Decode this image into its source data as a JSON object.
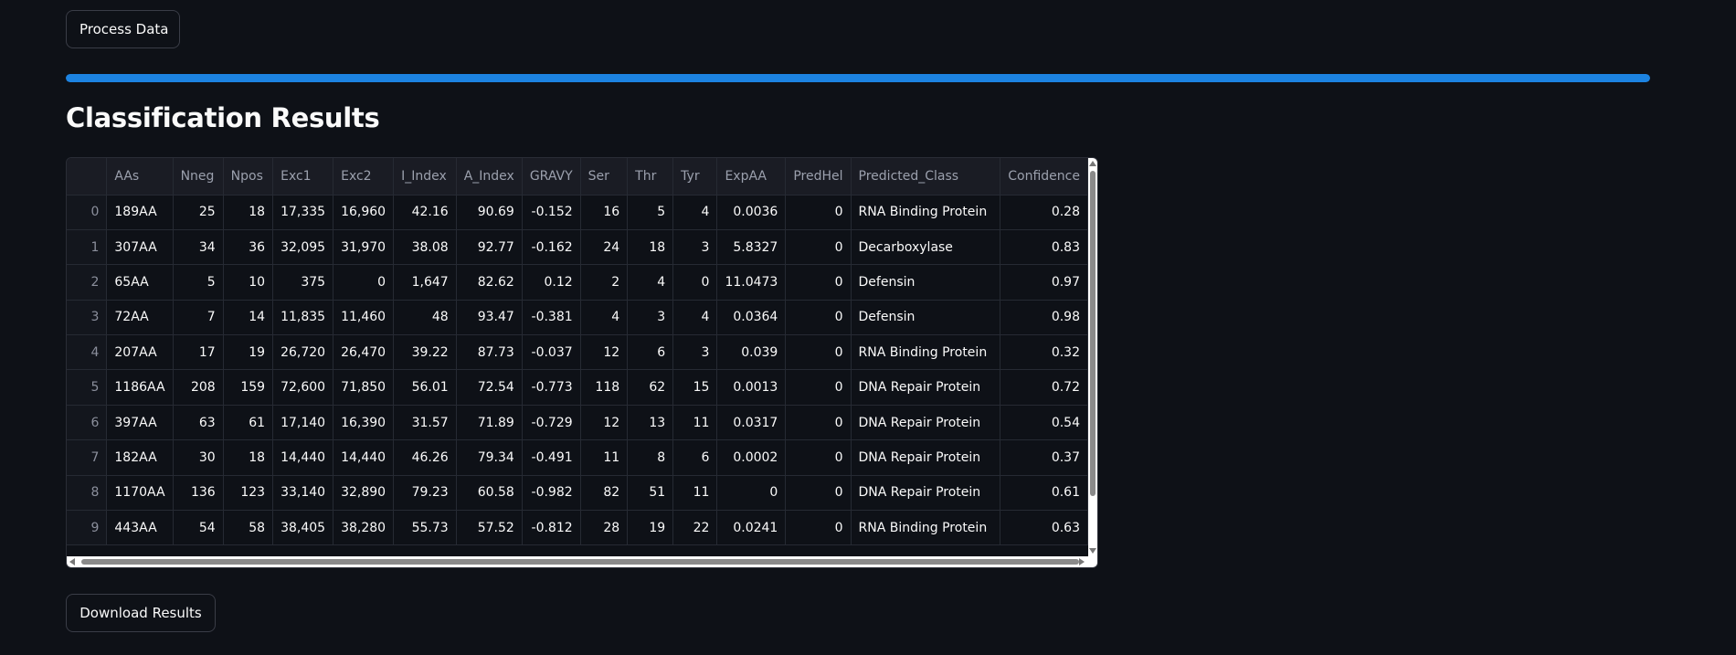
{
  "buttons": {
    "process_label": "Process Data",
    "download_label": "Download Results"
  },
  "progress": {
    "fraction": 1.0,
    "color": "#1c83e1"
  },
  "results": {
    "title": "Classification Results",
    "columns": [
      "",
      "AAs",
      "Nneg",
      "Npos",
      "Exc1",
      "Exc2",
      "I_Index",
      "A_Index",
      "GRAVY",
      "Ser",
      "Thr",
      "Tyr",
      "ExpAA",
      "PredHel",
      "Predicted_Class",
      "Confidence"
    ],
    "rows": [
      [
        "0",
        "189AA",
        "25",
        "18",
        "17,335",
        "16,960",
        "42.16",
        "90.69",
        "-0.152",
        "16",
        "5",
        "4",
        "0.0036",
        "0",
        "RNA Binding Protein",
        "0.28"
      ],
      [
        "1",
        "307AA",
        "34",
        "36",
        "32,095",
        "31,970",
        "38.08",
        "92.77",
        "-0.162",
        "24",
        "18",
        "3",
        "5.8327",
        "0",
        "Decarboxylase",
        "0.83"
      ],
      [
        "2",
        "65AA",
        "5",
        "10",
        "375",
        "0",
        "1,647",
        "82.62",
        "0.12",
        "2",
        "4",
        "0",
        "11.0473",
        "0",
        "Defensin",
        "0.97"
      ],
      [
        "3",
        "72AA",
        "7",
        "14",
        "11,835",
        "11,460",
        "48",
        "93.47",
        "-0.381",
        "4",
        "3",
        "4",
        "0.0364",
        "0",
        "Defensin",
        "0.98"
      ],
      [
        "4",
        "207AA",
        "17",
        "19",
        "26,720",
        "26,470",
        "39.22",
        "87.73",
        "-0.037",
        "12",
        "6",
        "3",
        "0.039",
        "0",
        "RNA Binding Protein",
        "0.32"
      ],
      [
        "5",
        "1186AA",
        "208",
        "159",
        "72,600",
        "71,850",
        "56.01",
        "72.54",
        "-0.773",
        "118",
        "62",
        "15",
        "0.0013",
        "0",
        "DNA Repair Protein",
        "0.72"
      ],
      [
        "6",
        "397AA",
        "63",
        "61",
        "17,140",
        "16,390",
        "31.57",
        "71.89",
        "-0.729",
        "12",
        "13",
        "11",
        "0.0317",
        "0",
        "DNA Repair Protein",
        "0.54"
      ],
      [
        "7",
        "182AA",
        "30",
        "18",
        "14,440",
        "14,440",
        "46.26",
        "79.34",
        "-0.491",
        "11",
        "8",
        "6",
        "0.0002",
        "0",
        "DNA Repair Protein",
        "0.37"
      ],
      [
        "8",
        "1170AA",
        "136",
        "123",
        "33,140",
        "32,890",
        "79.23",
        "60.58",
        "-0.982",
        "82",
        "51",
        "11",
        "0",
        "0",
        "DNA Repair Protein",
        "0.61"
      ],
      [
        "9",
        "443AA",
        "54",
        "58",
        "38,405",
        "38,280",
        "55.73",
        "57.52",
        "-0.812",
        "28",
        "19",
        "22",
        "0.0241",
        "0",
        "RNA Binding Protein",
        "0.63"
      ]
    ]
  }
}
